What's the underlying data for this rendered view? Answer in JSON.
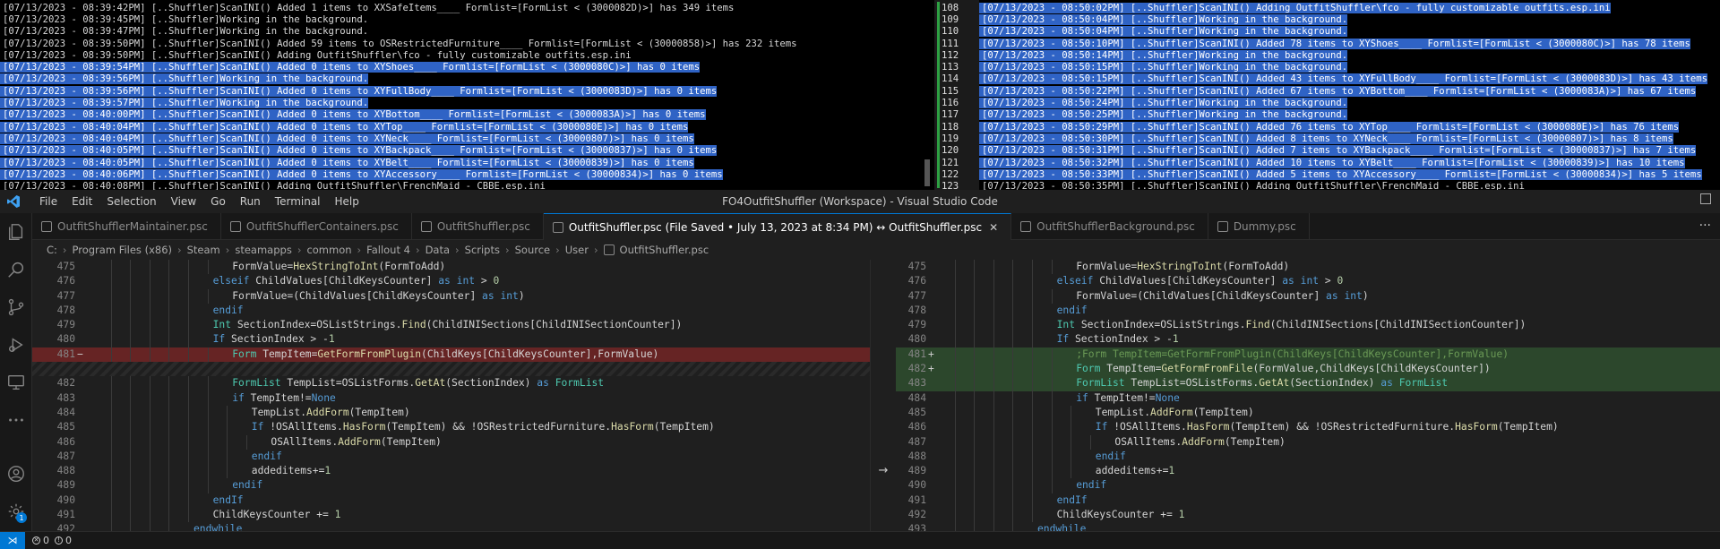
{
  "log_left": {
    "lines": [
      {
        "text": "[07/13/2023 - 08:39:42PM] [..Shuffler]ScanINI() Added 1 items to XXSafeItems____ Formlist=[FormList < (3000082D)>] has 349 items",
        "selected": false
      },
      {
        "text": "[07/13/2023 - 08:39:45PM] [..Shuffler]Working in the background.",
        "selected": false
      },
      {
        "text": "[07/13/2023 - 08:39:47PM] [..Shuffler]Working in the background.",
        "selected": false
      },
      {
        "text": "[07/13/2023 - 08:39:50PM] [..Shuffler]ScanINI() Added 59 items to OSRestrictedFurniture____ Formlist=[FormList < (30000858)>] has 232 items",
        "selected": false
      },
      {
        "text": "[07/13/2023 - 08:39:50PM] [..Shuffler]ScanINI() Adding OutfitShuffler\\fco - fully customizable outfits.esp.ini",
        "selected": false
      },
      {
        "text": "[07/13/2023 - 08:39:54PM] [..Shuffler]ScanINI() Added 0 items to XYShoes____ Formlist=[FormList < (3000080C)>] has 0 items",
        "selected": true
      },
      {
        "text": "[07/13/2023 - 08:39:56PM] [..Shuffler]Working in the background.",
        "selected": true
      },
      {
        "text": "[07/13/2023 - 08:39:56PM] [..Shuffler]ScanINI() Added 0 items to XYFullBody____ Formlist=[FormList < (3000083D)>] has 0 items",
        "selected": true
      },
      {
        "text": "[07/13/2023 - 08:39:57PM] [..Shuffler]Working in the background.",
        "selected": true
      },
      {
        "text": "[07/13/2023 - 08:40:00PM] [..Shuffler]ScanINI() Added 0 items to XYBottom____ Formlist=[FormList < (3000083A)>] has 0 items",
        "selected": true
      },
      {
        "text": "[07/13/2023 - 08:40:04PM] [..Shuffler]ScanINI() Added 0 items to XYTop____ Formlist=[FormList < (3000080E)>] has 0 items",
        "selected": true
      },
      {
        "text": "[07/13/2023 - 08:40:04PM] [..Shuffler]ScanINI() Added 0 items to XYNeck____ Formlist=[FormList < (30000807)>] has 0 items",
        "selected": true
      },
      {
        "text": "[07/13/2023 - 08:40:05PM] [..Shuffler]ScanINI() Added 0 items to XYBackpack____ Formlist=[FormList < (30000837)>] has 0 items",
        "selected": true
      },
      {
        "text": "[07/13/2023 - 08:40:05PM] [..Shuffler]ScanINI() Added 0 items to XYBelt____ Formlist=[FormList < (30000839)>] has 0 items",
        "selected": true
      },
      {
        "text": "[07/13/2023 - 08:40:06PM] [..Shuffler]ScanINI() Added 0 items to XYAccessory____ Formlist=[FormList < (30000834)>] has 0 items",
        "selected": true
      },
      {
        "text": "[07/13/2023 - 08:40:08PM] [..Shuffler]ScanINI() Adding OutfitShuffler\\FrenchMaid - CBBE.esp.ini",
        "selected": false
      }
    ]
  },
  "log_right": {
    "lines": [
      {
        "num": "108",
        "text": "[07/13/2023 - 08:50:02PM] [..Shuffler]ScanINI() Adding OutfitShuffler\\fco - fully customizable outfits.esp.ini",
        "selected": true
      },
      {
        "num": "109",
        "text": "[07/13/2023 - 08:50:04PM] [..Shuffler]Working in the background.",
        "selected": true
      },
      {
        "num": "110",
        "text": "[07/13/2023 - 08:50:04PM] [..Shuffler]Working in the background.",
        "selected": true
      },
      {
        "num": "111",
        "text": "[07/13/2023 - 08:50:10PM] [..Shuffler]ScanINI() Added 78 items to XYShoes____ Formlist=[FormList < (3000080C)>] has 78 items",
        "selected": true
      },
      {
        "num": "112",
        "text": "[07/13/2023 - 08:50:14PM] [..Shuffler]Working in the background.",
        "selected": true
      },
      {
        "num": "113",
        "text": "[07/13/2023 - 08:50:15PM] [..Shuffler]Working in the background.",
        "selected": true
      },
      {
        "num": "114",
        "text": "[07/13/2023 - 08:50:15PM] [..Shuffler]ScanINI() Added 43 items to XYFullBody____ Formlist=[FormList < (3000083D)>] has 43 items",
        "selected": true
      },
      {
        "num": "115",
        "text": "[07/13/2023 - 08:50:22PM] [..Shuffler]ScanINI() Added 67 items to XYBottom____ Formlist=[FormList < (3000083A)>] has 67 items",
        "selected": true
      },
      {
        "num": "116",
        "text": "[07/13/2023 - 08:50:24PM] [..Shuffler]Working in the background.",
        "selected": true
      },
      {
        "num": "117",
        "text": "[07/13/2023 - 08:50:25PM] [..Shuffler]Working in the background.",
        "selected": true
      },
      {
        "num": "118",
        "text": "[07/13/2023 - 08:50:29PM] [..Shuffler]ScanINI() Added 76 items to XYTop____ Formlist=[FormList < (3000080E)>] has 76 items",
        "selected": true
      },
      {
        "num": "119",
        "text": "[07/13/2023 - 08:50:30PM] [..Shuffler]ScanINI() Added 8 items to XYNeck____ Formlist=[FormList < (30000807)>] has 8 items",
        "selected": true
      },
      {
        "num": "120",
        "text": "[07/13/2023 - 08:50:31PM] [..Shuffler]ScanINI() Added 7 items to XYBackpack____ Formlist=[FormList < (30000837)>] has 7 items",
        "selected": true
      },
      {
        "num": "121",
        "text": "[07/13/2023 - 08:50:32PM] [..Shuffler]ScanINI() Added 10 items to XYBelt____ Formlist=[FormList < (30000839)>] has 10 items",
        "selected": true
      },
      {
        "num": "122",
        "text": "[07/13/2023 - 08:50:33PM] [..Shuffler]ScanINI() Added 5 items to XYAccessory____ Formlist=[FormList < (30000834)>] has 5 items",
        "selected": true
      },
      {
        "num": "123",
        "text": "[07/13/2023 - 08:50:35PM] [..Shuffler]ScanINI() Adding OutfitShuffler\\FrenchMaid - CBBE.esp.ini",
        "selected": false
      }
    ]
  },
  "vscode": {
    "window_title": "FO4OutfitShuffler (Workspace) - Visual Studio Code",
    "menu": [
      "File",
      "Edit",
      "Selection",
      "View",
      "Go",
      "Run",
      "Terminal",
      "Help"
    ],
    "tabs": [
      {
        "label": "OutfitShufflerMaintainer.psc",
        "active": false
      },
      {
        "label": "OutfitShufflerContainers.psc",
        "active": false
      },
      {
        "label": "OutfitShuffler.psc",
        "active": false
      },
      {
        "label": "OutfitShuffler.psc (File Saved • July 13, 2023 at 8:34 PM) ↔ OutfitShuffler.psc",
        "active": true
      },
      {
        "label": "OutfitShufflerBackground.psc",
        "active": false
      },
      {
        "label": "Dummy.psc",
        "active": false
      }
    ],
    "tab_close_glyph": "✕",
    "tab_more_glyph": "···",
    "breadcrumb": [
      "C:",
      "Program Files (x86)",
      "Steam",
      "steamapps",
      "common",
      "Fallout 4",
      "Data",
      "Scripts",
      "Source",
      "User",
      "OutfitShuffler.psc"
    ],
    "diff_arrow": "→",
    "status": {
      "remote_glyph": "⋊",
      "errors": "0",
      "warnings": "0"
    },
    "accent_color": "#0078d4",
    "settings_badge": "1"
  },
  "editor_left": [
    {
      "num": "475",
      "mark": "",
      "indent": 7,
      "html_key": "l475",
      "state": ""
    },
    {
      "num": "476",
      "mark": "",
      "indent": 6,
      "html_key": "l476",
      "state": ""
    },
    {
      "num": "477",
      "mark": "",
      "indent": 7,
      "html_key": "l477",
      "state": ""
    },
    {
      "num": "478",
      "mark": "",
      "indent": 6,
      "html_key": "l478",
      "state": ""
    },
    {
      "num": "479",
      "mark": "",
      "indent": 6,
      "html_key": "l479",
      "state": ""
    },
    {
      "num": "480",
      "mark": "",
      "indent": 6,
      "html_key": "l480",
      "state": ""
    },
    {
      "num": "481",
      "mark": "−",
      "indent": 7,
      "html_key": "l481old",
      "state": "removed"
    },
    {
      "num": "",
      "mark": "",
      "indent": 0,
      "html_key": "",
      "state": "filler"
    },
    {
      "num": "482",
      "mark": "",
      "indent": 7,
      "html_key": "l482",
      "state": ""
    },
    {
      "num": "483",
      "mark": "",
      "indent": 7,
      "html_key": "l483",
      "state": ""
    },
    {
      "num": "484",
      "mark": "",
      "indent": 8,
      "html_key": "l484",
      "state": ""
    },
    {
      "num": "485",
      "mark": "",
      "indent": 8,
      "html_key": "l485",
      "state": ""
    },
    {
      "num": "486",
      "mark": "",
      "indent": 9,
      "html_key": "l486",
      "state": ""
    },
    {
      "num": "487",
      "mark": "",
      "indent": 8,
      "html_key": "l487",
      "state": ""
    },
    {
      "num": "488",
      "mark": "",
      "indent": 8,
      "html_key": "l488",
      "state": ""
    },
    {
      "num": "489",
      "mark": "",
      "indent": 7,
      "html_key": "l489",
      "state": ""
    },
    {
      "num": "490",
      "mark": "",
      "indent": 6,
      "html_key": "l490",
      "state": ""
    },
    {
      "num": "491",
      "mark": "",
      "indent": 6,
      "html_key": "l491",
      "state": ""
    },
    {
      "num": "492",
      "mark": "",
      "indent": 5,
      "html_key": "l492",
      "state": ""
    }
  ],
  "editor_right": [
    {
      "num": "475",
      "mark": "",
      "indent": 7,
      "html_key": "l475",
      "state": ""
    },
    {
      "num": "476",
      "mark": "",
      "indent": 6,
      "html_key": "l476",
      "state": ""
    },
    {
      "num": "477",
      "mark": "",
      "indent": 7,
      "html_key": "l477",
      "state": ""
    },
    {
      "num": "478",
      "mark": "",
      "indent": 6,
      "html_key": "l478",
      "state": ""
    },
    {
      "num": "479",
      "mark": "",
      "indent": 6,
      "html_key": "l479",
      "state": ""
    },
    {
      "num": "480",
      "mark": "",
      "indent": 6,
      "html_key": "l480",
      "state": ""
    },
    {
      "num": "481",
      "mark": "+",
      "indent": 7,
      "html_key": "r481",
      "state": "added"
    },
    {
      "num": "482",
      "mark": "+",
      "indent": 7,
      "html_key": "r482",
      "state": "added"
    },
    {
      "num": "483",
      "mark": "",
      "indent": 7,
      "html_key": "l482",
      "state": "added"
    },
    {
      "num": "484",
      "mark": "",
      "indent": 7,
      "html_key": "l483",
      "state": ""
    },
    {
      "num": "485",
      "mark": "",
      "indent": 8,
      "html_key": "l484",
      "state": ""
    },
    {
      "num": "486",
      "mark": "",
      "indent": 8,
      "html_key": "l485",
      "state": ""
    },
    {
      "num": "487",
      "mark": "",
      "indent": 9,
      "html_key": "l486",
      "state": ""
    },
    {
      "num": "488",
      "mark": "",
      "indent": 8,
      "html_key": "l487",
      "state": ""
    },
    {
      "num": "489",
      "mark": "",
      "indent": 8,
      "html_key": "l488",
      "state": ""
    },
    {
      "num": "490",
      "mark": "",
      "indent": 7,
      "html_key": "l489",
      "state": ""
    },
    {
      "num": "491",
      "mark": "",
      "indent": 6,
      "html_key": "l490",
      "state": ""
    },
    {
      "num": "492",
      "mark": "",
      "indent": 6,
      "html_key": "l491",
      "state": ""
    },
    {
      "num": "493",
      "mark": "",
      "indent": 5,
      "html_key": "l492",
      "state": ""
    }
  ],
  "code_tokens": {
    "l475": [
      [
        "vr",
        "FormValue="
      ],
      [
        "fn",
        "HexStringToInt"
      ],
      [
        "vr",
        "(FormToAdd)"
      ]
    ],
    "l476": [
      [
        "kw",
        "elseif "
      ],
      [
        "vr",
        "ChildValues[ChildKeysCounter] "
      ],
      [
        "kw",
        "as int"
      ],
      [
        "vr",
        " > "
      ],
      [
        "nm",
        "0"
      ]
    ],
    "l477": [
      [
        "vr",
        "FormValue=(ChildValues[ChildKeysCounter] "
      ],
      [
        "kw",
        "as int"
      ],
      [
        "vr",
        ")"
      ]
    ],
    "l478": [
      [
        "kw",
        "endif"
      ]
    ],
    "l479": [
      [
        "ty",
        "Int "
      ],
      [
        "vr",
        "SectionIndex=OSListStrings."
      ],
      [
        "fn",
        "Find"
      ],
      [
        "vr",
        "(ChildINISections[ChildINISectionCounter])"
      ]
    ],
    "l480": [
      [
        "kw",
        "If "
      ],
      [
        "vr",
        "SectionIndex > -"
      ],
      [
        "nm",
        "1"
      ]
    ],
    "l481old": [
      [
        "ty",
        "Form "
      ],
      [
        "vr",
        "TempItem="
      ],
      [
        "fn",
        "GetFormFromPlugin"
      ],
      [
        "vr",
        "(ChildKeys[ChildKeysCounter],FormValue)"
      ]
    ],
    "r481": [
      [
        "cm",
        ";Form TempItem=GetFormFromPlugin(ChildKeys[ChildKeysCounter],FormValue)"
      ]
    ],
    "r482": [
      [
        "ty",
        "Form "
      ],
      [
        "vr",
        "TempItem="
      ],
      [
        "fn",
        "GetFormFromFile"
      ],
      [
        "vr",
        "(FormValue,ChildKeys[ChildKeysCounter])"
      ]
    ],
    "l482": [
      [
        "ty",
        "FormList "
      ],
      [
        "vr",
        "TempList=OSListForms."
      ],
      [
        "fn",
        "GetAt"
      ],
      [
        "vr",
        "(SectionIndex) "
      ],
      [
        "kw",
        "as "
      ],
      [
        "ty",
        "FormList"
      ]
    ],
    "l483": [
      [
        "kw",
        "if "
      ],
      [
        "vr",
        "TempItem!="
      ],
      [
        "kw",
        "None"
      ]
    ],
    "l484": [
      [
        "vr",
        "TempList."
      ],
      [
        "fn",
        "AddForm"
      ],
      [
        "vr",
        "(TempItem)"
      ]
    ],
    "l485": [
      [
        "kw",
        "If "
      ],
      [
        "vr",
        "!OSAllItems."
      ],
      [
        "fn",
        "HasForm"
      ],
      [
        "vr",
        "(TempItem) && !OSRestrictedFurniture."
      ],
      [
        "fn",
        "HasForm"
      ],
      [
        "vr",
        "(TempItem)"
      ]
    ],
    "l486": [
      [
        "vr",
        "OSAllItems."
      ],
      [
        "fn",
        "AddForm"
      ],
      [
        "vr",
        "(TempItem)"
      ]
    ],
    "l487": [
      [
        "kw",
        "endif"
      ]
    ],
    "l488": [
      [
        "vr",
        "addeditems+="
      ],
      [
        "nm",
        "1"
      ]
    ],
    "l489": [
      [
        "kw",
        "endif"
      ]
    ],
    "l490": [
      [
        "kw",
        "endIf"
      ]
    ],
    "l491": [
      [
        "vr",
        "ChildKeysCounter += "
      ],
      [
        "nm",
        "1"
      ]
    ],
    "l492": [
      [
        "kw",
        "endwhile"
      ]
    ]
  }
}
